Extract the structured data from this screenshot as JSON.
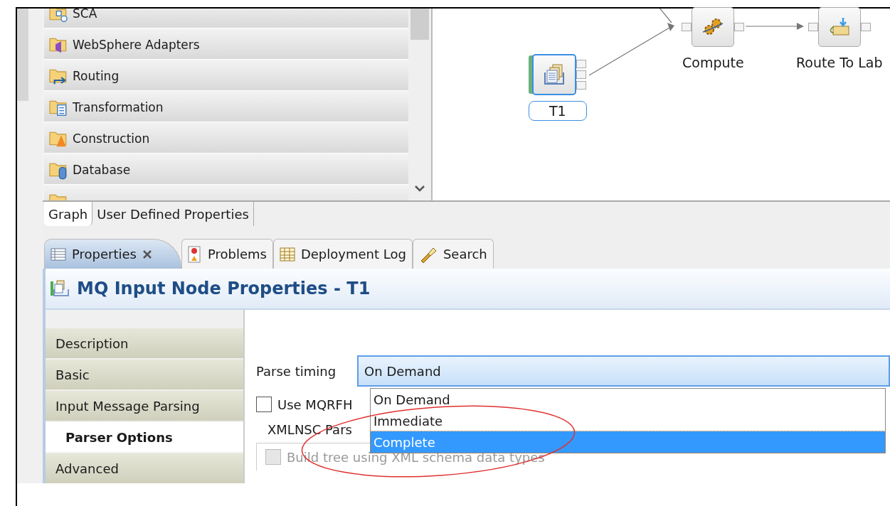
{
  "palette": {
    "drawers": [
      {
        "label": "SCA",
        "kind": "sca"
      },
      {
        "label": "WebSphere Adapters",
        "kind": "adapters"
      },
      {
        "label": "Routing",
        "kind": "routing"
      },
      {
        "label": "Transformation",
        "kind": "transformation"
      },
      {
        "label": "Construction",
        "kind": "construction"
      },
      {
        "label": "Database",
        "kind": "database"
      },
      {
        "kind": "file"
      }
    ]
  },
  "canvas": {
    "nodes": [
      {
        "label": "T1",
        "kind": "input",
        "selected": true
      },
      {
        "label": "Compute",
        "kind": "compute",
        "selected": false
      },
      {
        "label": "Route To Lab",
        "kind": "route",
        "selected": false
      }
    ]
  },
  "editor_tabs": [
    {
      "label": "Graph",
      "selected": true
    },
    {
      "label": "User Defined Properties",
      "selected": false
    }
  ],
  "view_tabs": [
    {
      "label": "Properties",
      "kind": "properties",
      "selected": true,
      "closable": true
    },
    {
      "label": "Problems",
      "kind": "problems",
      "selected": false,
      "closable": false
    },
    {
      "label": "Deployment Log",
      "kind": "log",
      "selected": false,
      "closable": false
    },
    {
      "label": "Search",
      "kind": "search",
      "selected": false,
      "closable": false
    }
  ],
  "properties": {
    "title": "MQ Input Node Properties - T1",
    "sections": [
      {
        "label": "Description",
        "selected": false
      },
      {
        "label": "Basic",
        "selected": false
      },
      {
        "label": "Input Message Parsing",
        "selected": false
      },
      {
        "label": "Parser Options",
        "selected": true
      },
      {
        "label": "Advanced",
        "selected": false
      }
    ],
    "parse_timing": {
      "label": "Parse timing",
      "value": "On Demand",
      "expanded": true,
      "options": [
        {
          "label": "On Demand",
          "highlighted": false
        },
        {
          "label": "Immediate",
          "highlighted": false
        },
        {
          "label": "Complete",
          "highlighted": true
        }
      ]
    },
    "use_mqrfh2c": {
      "label": "Use MQRFH",
      "checked": false
    },
    "xmlnsc_group": {
      "label": "XMLNSC Pars",
      "build_tree": {
        "label": "Build tree using XML schema data types",
        "checked": false,
        "disabled": true
      }
    }
  }
}
